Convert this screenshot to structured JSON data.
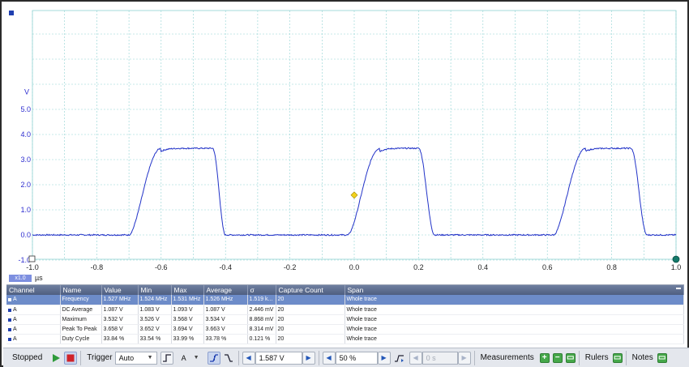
{
  "scope": {
    "y_unit": "V",
    "y_ticks": [
      "5.0",
      "4.0",
      "3.0",
      "2.0",
      "1.0",
      "0.0",
      "-1.0"
    ],
    "x_unit": "µs",
    "x_ticks": [
      "-1.0",
      "-0.8",
      "-0.6",
      "-0.4",
      "-0.2",
      "0.0",
      "0.2",
      "0.4",
      "0.6",
      "0.8",
      "1.0"
    ],
    "channel_tag": "x1.0",
    "trace_color": "#2233c8",
    "trigger_marker_color": "#f2d21b",
    "trigger_level_v": 1.587,
    "trace_high_v": 3.45,
    "trace_low_v": 0.0
  },
  "measurements": {
    "columns": [
      "Channel",
      "Name",
      "Value",
      "Min",
      "Max",
      "Average",
      "σ",
      "Capture Count",
      "Span"
    ],
    "rows": [
      {
        "channel": "A",
        "name": "Frequency",
        "value": "1.527 MHz",
        "min": "1.524 MHz",
        "max": "1.531 MHz",
        "average": "1.526 MHz",
        "sigma": "1.519 k...",
        "count": "20",
        "span": "Whole trace"
      },
      {
        "channel": "A",
        "name": "DC Average",
        "value": "1.087 V",
        "min": "1.083 V",
        "max": "1.093 V",
        "average": "1.087 V",
        "sigma": "2.446 mV",
        "count": "20",
        "span": "Whole trace"
      },
      {
        "channel": "A",
        "name": "Maximum",
        "value": "3.532 V",
        "min": "3.526 V",
        "max": "3.568 V",
        "average": "3.534 V",
        "sigma": "8.868 mV",
        "count": "20",
        "span": "Whole trace"
      },
      {
        "channel": "A",
        "name": "Peak To Peak",
        "value": "3.658 V",
        "min": "3.652 V",
        "max": "3.694 V",
        "average": "3.663 V",
        "sigma": "8.314 mV",
        "count": "20",
        "span": "Whole trace"
      },
      {
        "channel": "A",
        "name": "Duty Cycle",
        "value": "33.84 %",
        "min": "33.54 %",
        "max": "33.99 %",
        "average": "33.78 %",
        "sigma": "0.121 %",
        "count": "20",
        "span": "Whole trace"
      }
    ]
  },
  "toolbar": {
    "status": "Stopped",
    "trigger_label": "Trigger",
    "trigger_mode": "Auto",
    "trigger_channel": "A",
    "threshold": "1.587 V",
    "pretrigger": "50 %",
    "delay": "0 s",
    "measurements_label": "Measurements",
    "rulers_label": "Rulers",
    "notes_label": "Notes"
  }
}
